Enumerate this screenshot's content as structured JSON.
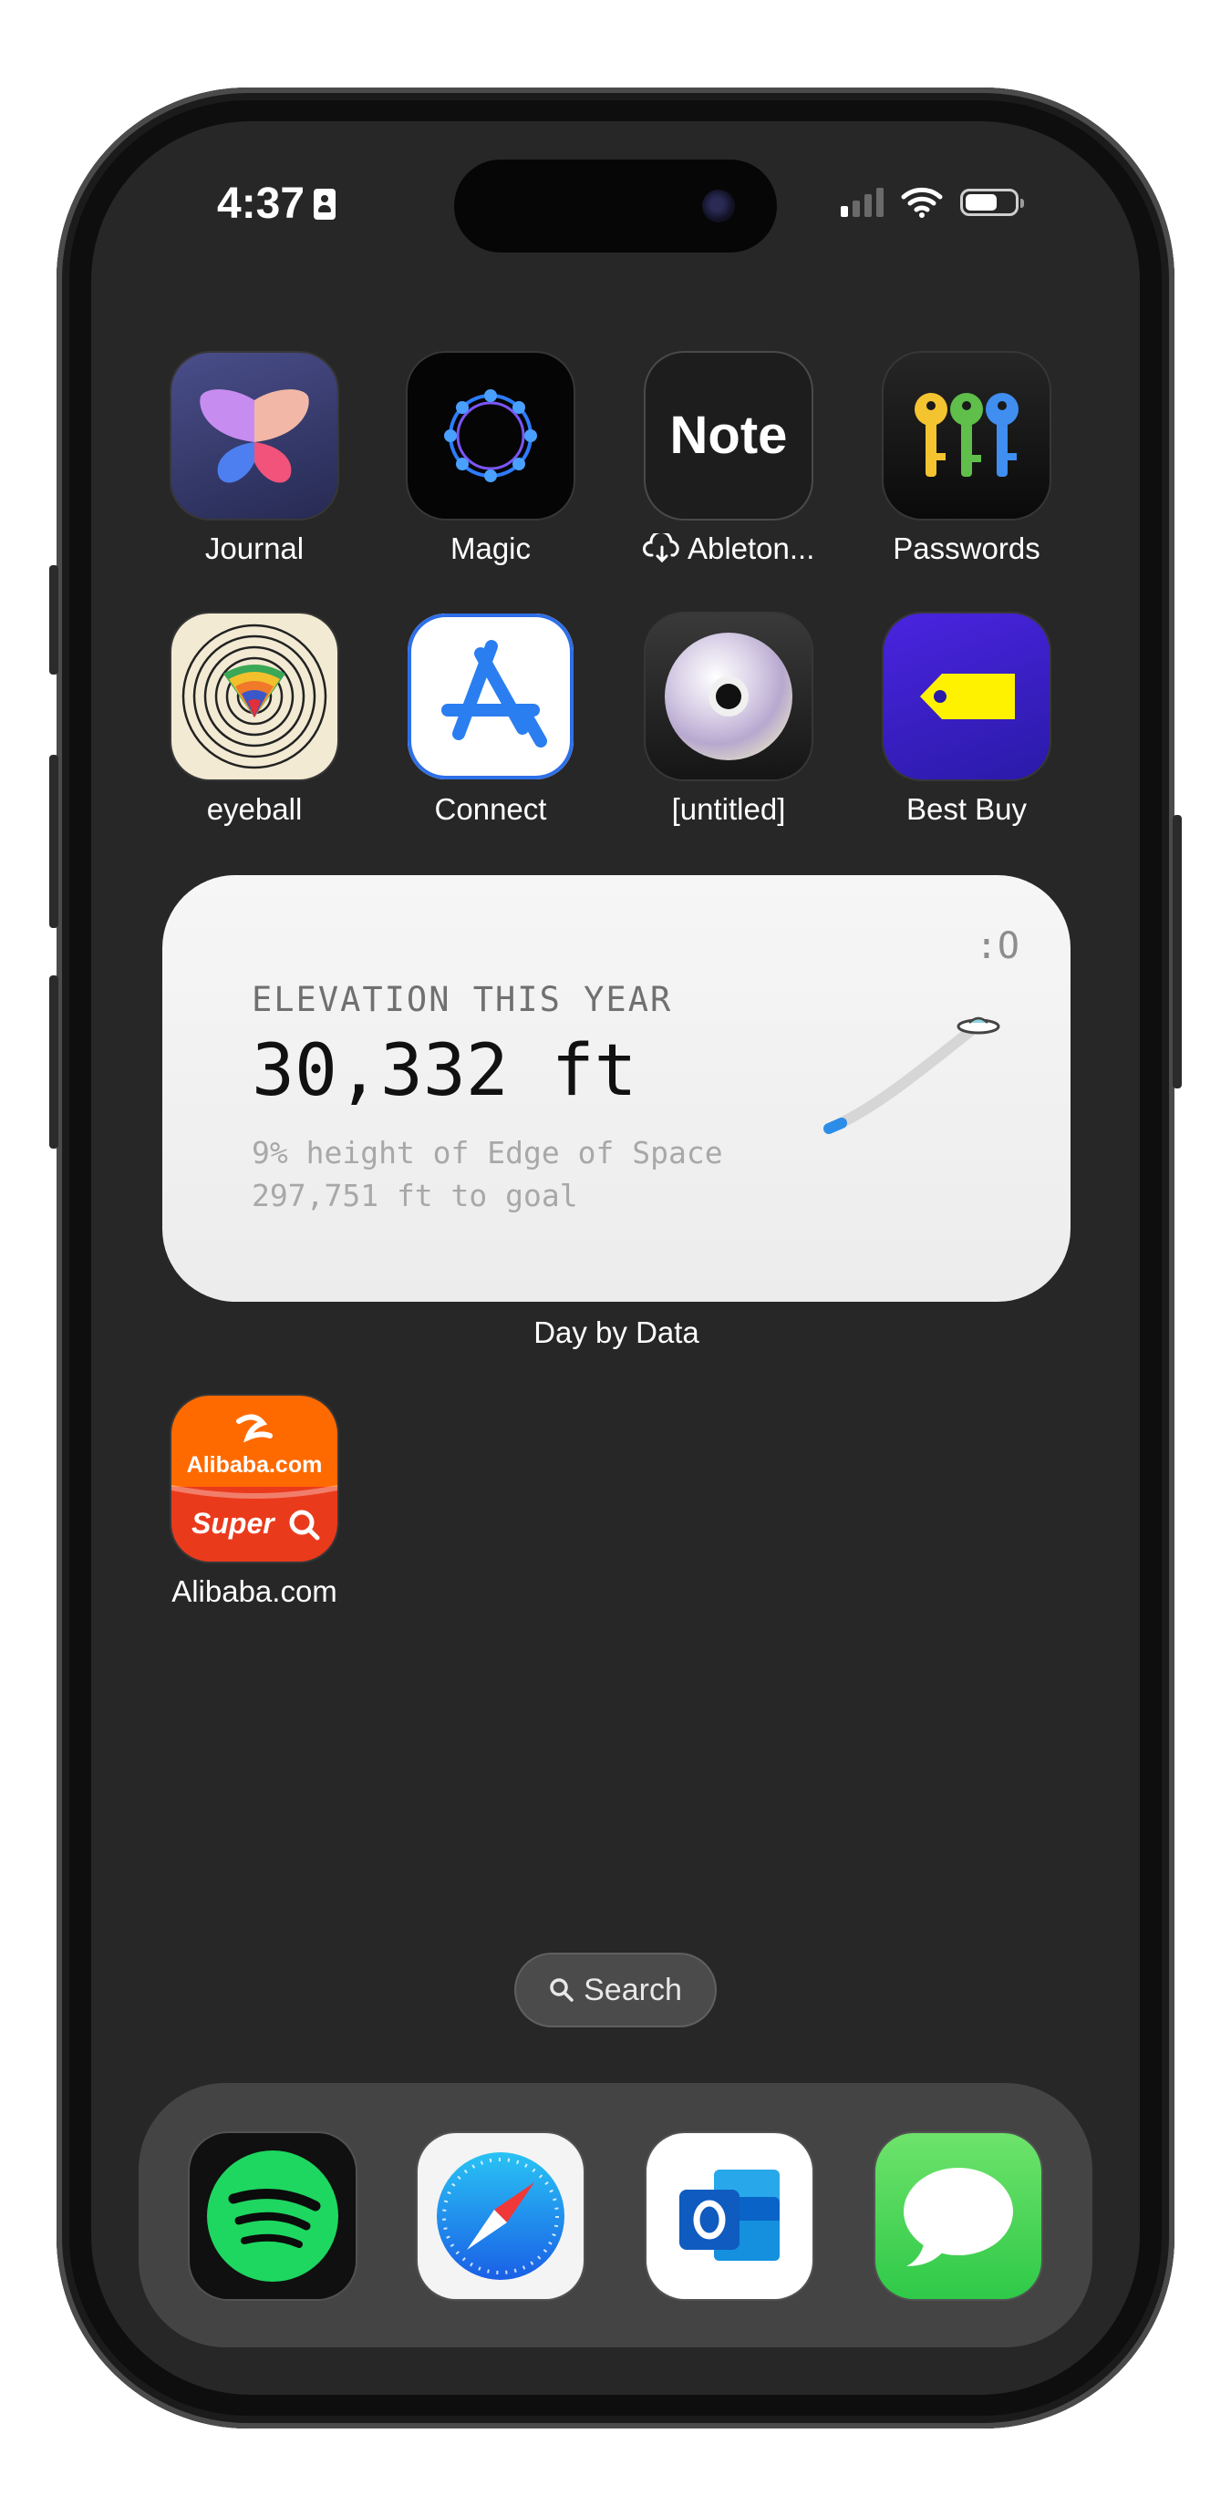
{
  "status_bar": {
    "time": "4:37"
  },
  "home": {
    "row1": [
      {
        "label": "Journal",
        "icon": "journal-icon"
      },
      {
        "label": "Magic",
        "icon": "magic-icon"
      },
      {
        "label": "Ableton...",
        "icon": "note-icon",
        "icon_text": "Note"
      },
      {
        "label": "Passwords",
        "icon": "passwords-icon"
      }
    ],
    "row2": [
      {
        "label": "eyeball",
        "icon": "eyeball-icon"
      },
      {
        "label": "Connect",
        "icon": "app-store-connect-icon"
      },
      {
        "label": "[untitled]",
        "icon": "cd-icon"
      },
      {
        "label": "Best Buy",
        "icon": "best-buy-icon"
      }
    ],
    "row3": [
      {
        "label": "Alibaba.com",
        "icon": "alibaba-icon",
        "icon_text_top": "Alibaba.com",
        "icon_text_bottom": "Super"
      }
    ]
  },
  "widget": {
    "title": "ELEVATION THIS YEAR",
    "value": "30,332 ft",
    "line1": "9% height of Edge of Space",
    "line2": "297,751 ft to goal",
    "corner": ":O",
    "app_label": "Day by Data",
    "progress_fraction": 0.09
  },
  "search": {
    "label": "Search"
  },
  "dock": [
    {
      "name": "spotify",
      "icon": "spotify-icon"
    },
    {
      "name": "safari",
      "icon": "safari-icon"
    },
    {
      "name": "outlook",
      "icon": "outlook-icon"
    },
    {
      "name": "messages",
      "icon": "messages-icon"
    }
  ],
  "colors": {
    "screen_bg": "#272727",
    "best_buy_blue": "#3a1fd4",
    "best_buy_yellow": "#fff200",
    "alibaba_orange": "#ff6a00",
    "spotify_green": "#1ed760",
    "messages_green": "#3fd957"
  }
}
